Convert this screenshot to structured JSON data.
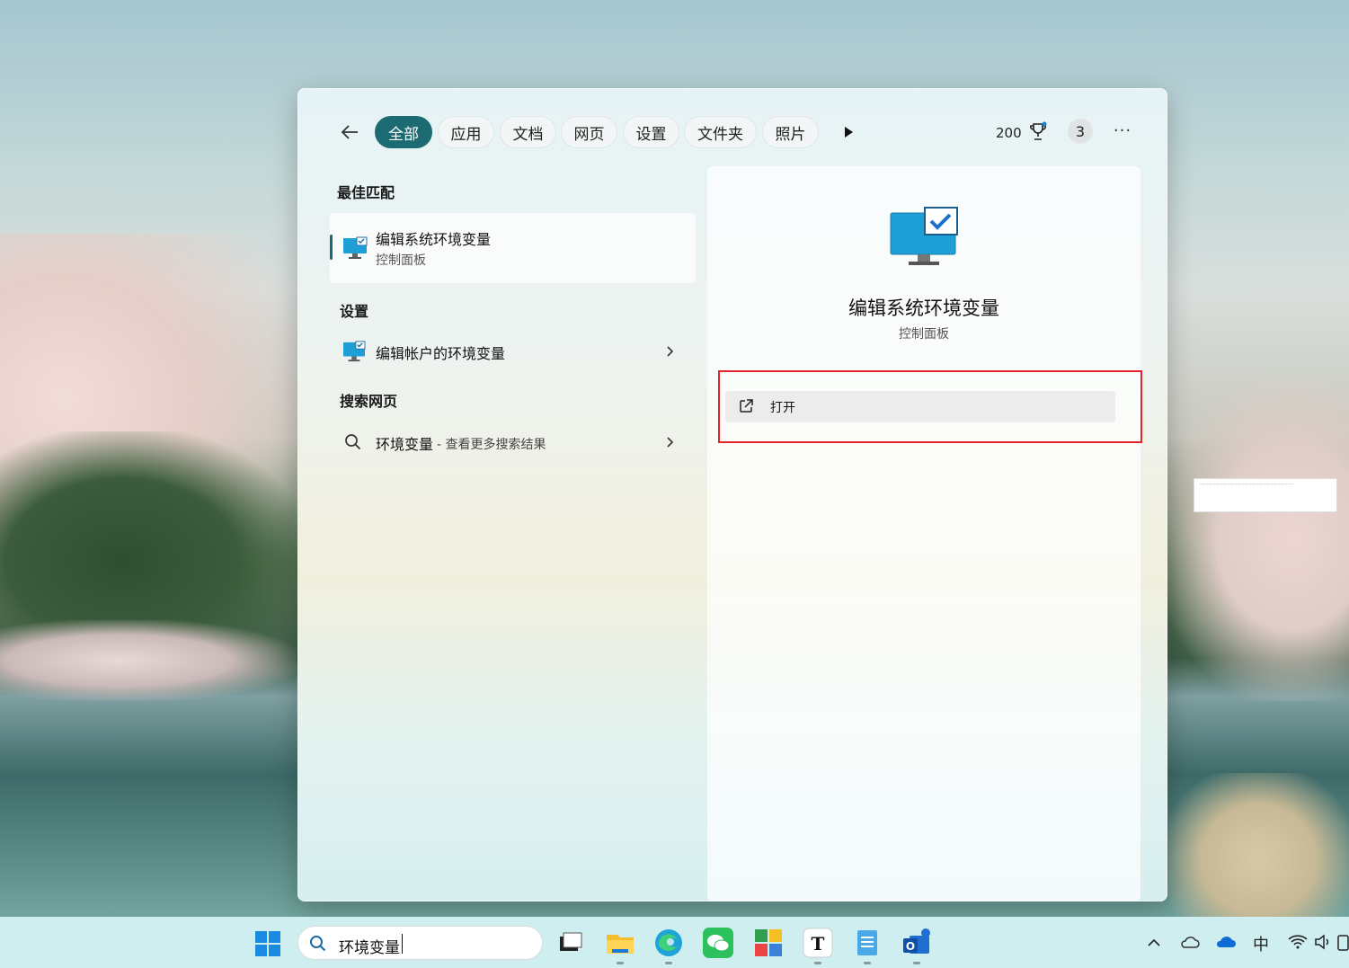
{
  "desktop": {
    "note_text": "……………………………………………………………………"
  },
  "filters": {
    "back_label": "←",
    "tabs": [
      {
        "label": "全部",
        "active": true
      },
      {
        "label": "应用"
      },
      {
        "label": "文档"
      },
      {
        "label": "网页"
      },
      {
        "label": "设置"
      },
      {
        "label": "文件夹"
      },
      {
        "label": "照片"
      }
    ],
    "points": "200",
    "notification_count": "3",
    "more_label": "···"
  },
  "results": {
    "best_match_heading": "最佳匹配",
    "best_match": {
      "title": "编辑系统环境变量",
      "subtitle": "控制面板"
    },
    "settings_heading": "设置",
    "settings_item": {
      "title": "编辑帐户的环境变量"
    },
    "web_heading": "搜索网页",
    "web_item": {
      "query": "环境变量",
      "hint": " - 查看更多搜索结果"
    }
  },
  "detail": {
    "title": "编辑系统环境变量",
    "subtitle": "控制面板",
    "action_open": "打开"
  },
  "taskbar": {
    "search_text": "环境变量",
    "apps": [
      "task-view",
      "file-explorer",
      "edge",
      "wechat",
      "app-grid",
      "typora",
      "notepad",
      "outlook"
    ],
    "tray": {
      "ime": "中"
    }
  },
  "colors": {
    "accent": "#1c6b73",
    "highlight_box": "#e0242b"
  }
}
